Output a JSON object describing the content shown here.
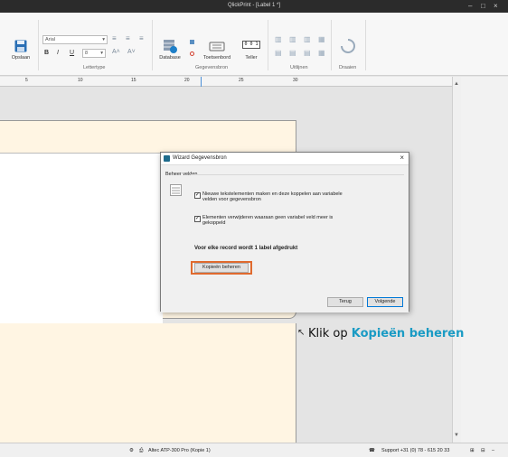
{
  "window": {
    "title": "QlickPrint - [Label 1 *]"
  },
  "ribbon": {
    "save_label": "Opslaan",
    "font_name": "Arial",
    "font_size": "8",
    "group_font": "Lettertype",
    "database_label": "Database",
    "keyboard_label": "Toetsenbord",
    "counter_label": "Teller",
    "counter_display": "0 0 1",
    "group_datasource": "Gegevensbron",
    "group_align": "Uitlijnen",
    "group_rotate": "Draaien",
    "bold": "B",
    "italic": "I",
    "underline": "U"
  },
  "ruler": {
    "numbers": [
      "5",
      "10",
      "15",
      "20",
      "25",
      "30"
    ]
  },
  "dialog": {
    "title": "Wizard Gegevensbron",
    "section": "Beheer velden",
    "checkbox1": "Nieuwe tekstelementen maken en deze koppelen aan variabele velden voor gegevensbron",
    "checkbox2": "Elementen verwijderen waaraan geen variabel veld meer is gekoppeld",
    "info": "Voor elke record wordt 1 label afgedrukt",
    "manage_copies": "Kopieën beheren",
    "back": "Terug",
    "next": "Volgende"
  },
  "callout": {
    "prefix": "Klik op ",
    "highlight": "Kopieën beheren"
  },
  "status": {
    "printer": "Altec ATP-300 Pro (Kopie 1)",
    "support": "Support +31 (0) 78 - 615 20 33"
  },
  "colors": {
    "accent": "#1a9bc4",
    "highlight_border": "#e06a2e",
    "label_bg": "#fff5e3"
  }
}
